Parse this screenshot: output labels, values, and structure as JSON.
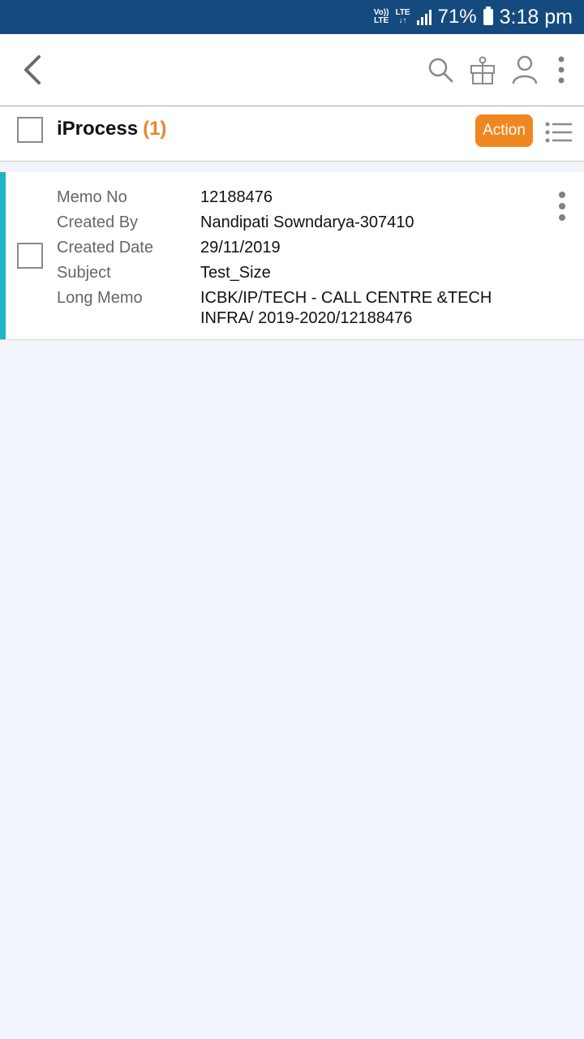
{
  "status_bar": {
    "network_top": "Vo))",
    "network_bottom": "LTE",
    "lte_label": "LTE",
    "lte_arrows": "↓↑",
    "battery": "71%",
    "time": "3:18 pm"
  },
  "icons": {
    "back": "back-arrow-icon",
    "search": "search-icon",
    "gift": "gift-icon",
    "user": "user-icon",
    "more": "more-vertical-icon",
    "list": "list-view-icon"
  },
  "header": {
    "title": "iProcess",
    "count": "(1)",
    "action_label": "Action"
  },
  "colors": {
    "status_bar": "#154a7e",
    "accent_orange": "#f0861f",
    "card_accent": "#1fb5c4",
    "background": "#f2f6fc"
  },
  "memo": {
    "fields": [
      {
        "label": "Memo No",
        "value": "12188476"
      },
      {
        "label": "Created By",
        "value": "Nandipati Sowndarya-307410"
      },
      {
        "label": "Created Date",
        "value": "29/11/2019"
      },
      {
        "label": "Subject",
        "value": "Test_Size"
      },
      {
        "label": "Long Memo",
        "value": "ICBK/IP/TECH - CALL CENTRE &TECH INFRA/ 2019-2020/12188476"
      }
    ]
  }
}
